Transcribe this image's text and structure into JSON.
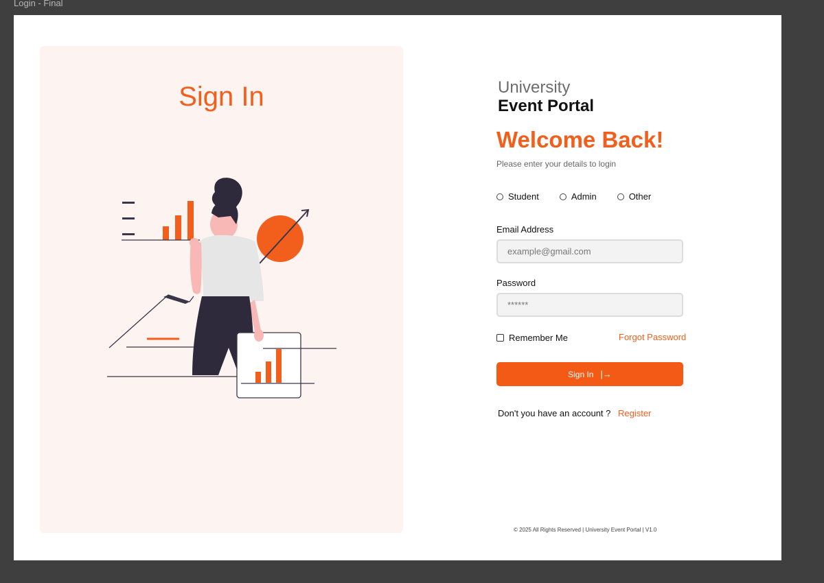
{
  "window": {
    "title": "Login - Final"
  },
  "colors": {
    "accent": "#f25f1c",
    "panel_bg": "#fdf4f1",
    "frame_bg": "#3f3f3f"
  },
  "left_panel": {
    "title": "Sign In",
    "illustration_icon": "woman-analytics-illustration"
  },
  "brand": {
    "line1": "University",
    "line2": "Event Portal"
  },
  "heading": "Welcome Back!",
  "subtitle": "Please enter your details to login",
  "roles": [
    {
      "label": "Student",
      "selected": false
    },
    {
      "label": "Admin",
      "selected": false
    },
    {
      "label": "Other",
      "selected": false
    }
  ],
  "email": {
    "label": "Email Address",
    "placeholder": "example@gmail.com",
    "value": ""
  },
  "password": {
    "label": "Password",
    "placeholder": "******",
    "value": ""
  },
  "remember_me": {
    "label": "Remember Me",
    "checked": false
  },
  "forgot_password": "Forgot Password",
  "signin_button": {
    "label": "Sign In",
    "icon": "sign-in-arrow-icon"
  },
  "register": {
    "prompt": "Don't you have an account ?",
    "link": "Register"
  },
  "footer": "© 2025 All Rights Reserved | University Event Portal | V1.0"
}
